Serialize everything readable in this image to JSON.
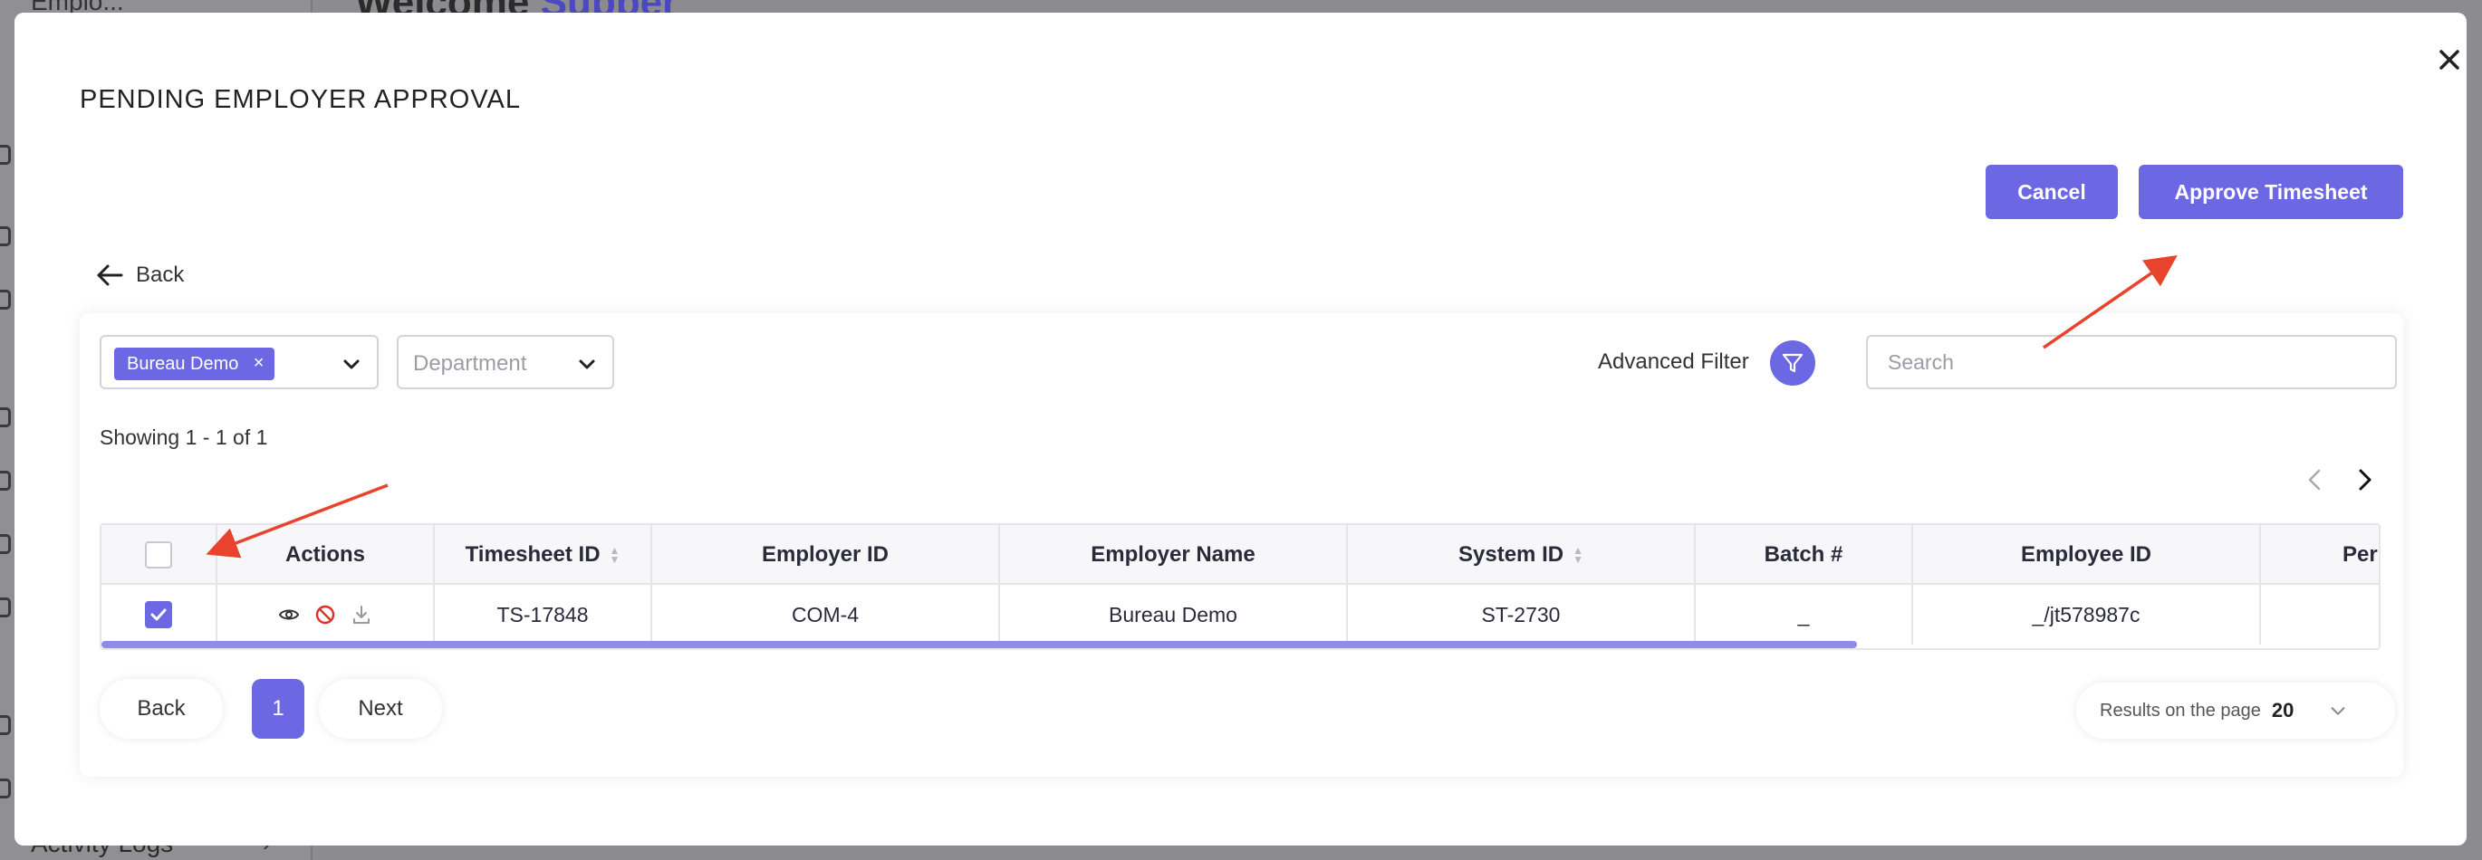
{
  "background": {
    "top_text": "Emplo...",
    "welcome_prefix": "Welcome ",
    "welcome_name": "Supper",
    "activity_logs": "Activity Logs"
  },
  "modal": {
    "title": "PENDING EMPLOYER APPROVAL",
    "cancel_label": "Cancel",
    "approve_label": "Approve Timesheet",
    "back_label": "Back"
  },
  "filters": {
    "employer_chip": "Bureau Demo",
    "department_placeholder": "Department",
    "advanced_filter_label": "Advanced Filter",
    "search_placeholder": "Search",
    "showing": "Showing 1 - 1 of 1"
  },
  "table": {
    "columns": [
      "Actions",
      "Timesheet ID",
      "Employer ID",
      "Employer Name",
      "System ID",
      "Batch #",
      "Employee ID",
      "Peri"
    ],
    "rows": [
      {
        "checked": true,
        "timesheet_id": "TS-17848",
        "employer_id": "COM-4",
        "employer_name": "Bureau Demo",
        "system_id": "ST-2730",
        "batch": "_",
        "employee_id": "_/jt578987c",
        "period": ""
      }
    ]
  },
  "pagination": {
    "back_label": "Back",
    "current_page": "1",
    "next_label": "Next",
    "results_label": "Results on the page",
    "results_value": "20"
  },
  "colors": {
    "accent": "#6c67e2",
    "annotation_arrow": "#e8432d"
  }
}
